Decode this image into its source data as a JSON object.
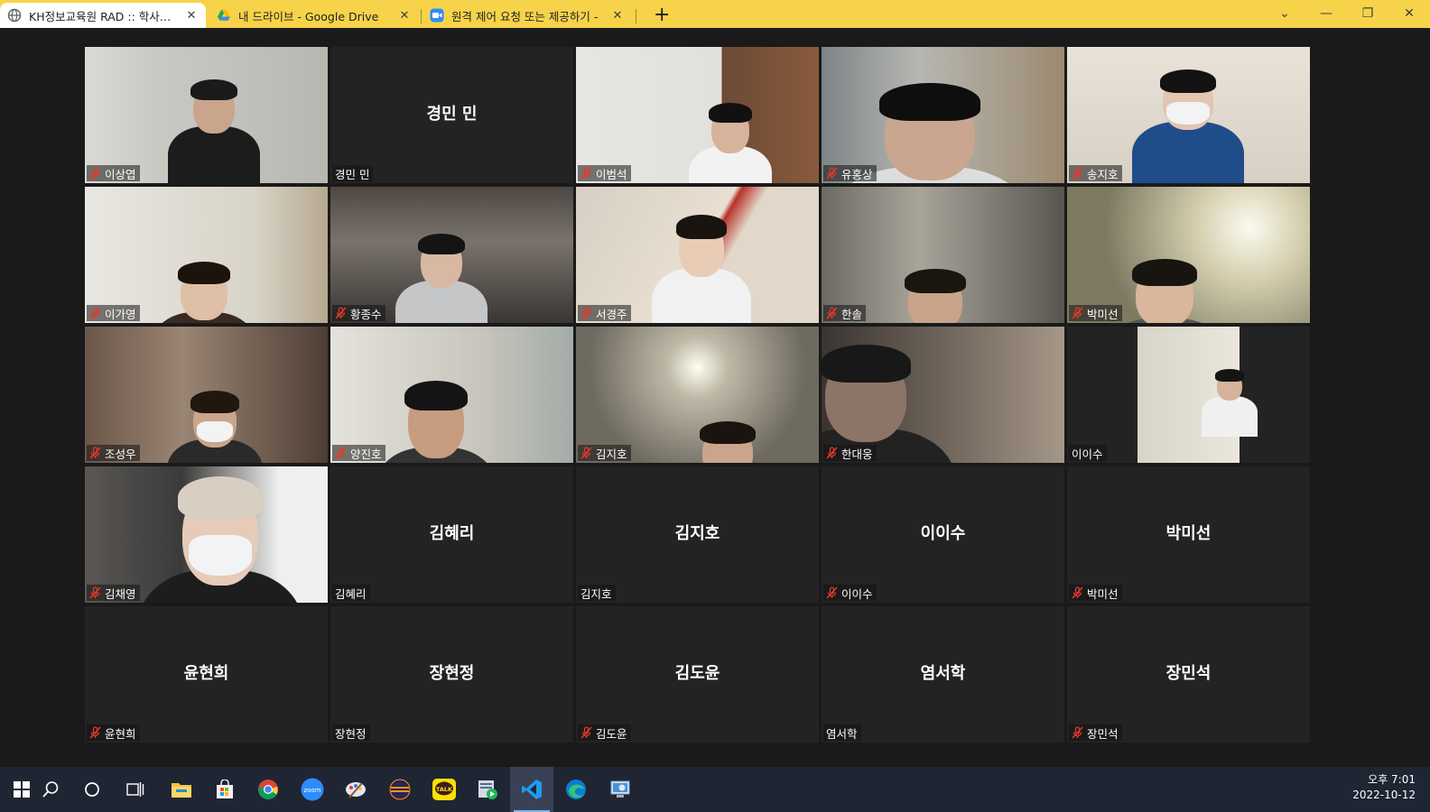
{
  "browser": {
    "tabs": [
      {
        "title": "KH정보교육원 RAD :: 학사관리",
        "active": true,
        "icon": "globe-icon"
      },
      {
        "title": "내 드라이브 - Google Drive",
        "active": false,
        "icon": "google-drive-icon"
      },
      {
        "title": "원격 제어 요청 또는 제공하기 -",
        "active": false,
        "icon": "zoom-icon"
      }
    ],
    "new_tab_label": "+",
    "close_label": "✕"
  },
  "gallery": {
    "tiles": [
      {
        "name": "이상엽",
        "video": true,
        "muted": true
      },
      {
        "name": "경민 민",
        "video": false,
        "muted": false
      },
      {
        "name": "이범석",
        "video": true,
        "muted": true
      },
      {
        "name": "유홍상",
        "video": true,
        "muted": true
      },
      {
        "name": "송지호",
        "video": true,
        "muted": true
      },
      {
        "name": "이가영",
        "video": true,
        "muted": true
      },
      {
        "name": "황종수",
        "video": true,
        "muted": true
      },
      {
        "name": "서경주",
        "video": true,
        "muted": true
      },
      {
        "name": "한솔",
        "video": true,
        "muted": true
      },
      {
        "name": "박미선",
        "video": true,
        "muted": true
      },
      {
        "name": "조성우",
        "video": true,
        "muted": true
      },
      {
        "name": "양진호",
        "video": true,
        "muted": true
      },
      {
        "name": "김지호",
        "video": true,
        "muted": true
      },
      {
        "name": "한대웅",
        "video": true,
        "muted": true
      },
      {
        "name": "이이수",
        "video": true,
        "muted": false
      },
      {
        "name": "김채영",
        "video": true,
        "muted": true
      },
      {
        "name": "김혜리",
        "video": false,
        "muted": false
      },
      {
        "name": "김지호",
        "video": false,
        "muted": false
      },
      {
        "name": "이이수",
        "video": false,
        "muted": true
      },
      {
        "name": "박미선",
        "video": false,
        "muted": true
      },
      {
        "name": "윤현희",
        "video": false,
        "muted": true
      },
      {
        "name": "장현정",
        "video": false,
        "muted": false
      },
      {
        "name": "김도윤",
        "video": false,
        "muted": true
      },
      {
        "name": "염서학",
        "video": false,
        "muted": false
      },
      {
        "name": "장민석",
        "video": false,
        "muted": true
      }
    ]
  },
  "taskbar": {
    "apps": [
      "windows-start-icon",
      "search-icon",
      "cortana-icon",
      "task-view-icon",
      "file-explorer-icon",
      "microsoft-store-icon",
      "chrome-icon",
      "zoom-app-icon",
      "paint-app-icon",
      "eclipse-icon",
      "kakaotalk-icon",
      "media-app-icon",
      "vscode-icon",
      "edge-icon",
      "remote-support-icon"
    ],
    "zoom_label": "zoom",
    "talk_label": "TALK",
    "time": "오후 7:01",
    "date": "2022-10-12"
  },
  "colors": {
    "tabbar": "#f7d34a",
    "gallery_bg": "#1a1a1a",
    "tile_bg": "#232323",
    "muted_red": "#e8382b",
    "taskbar": "#1f2533"
  }
}
